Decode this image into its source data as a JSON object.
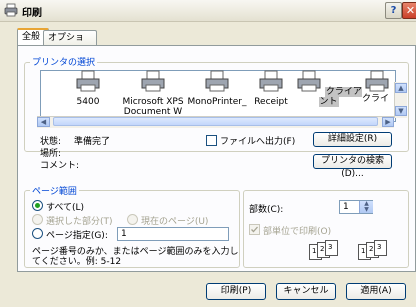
{
  "window": {
    "title": "印刷",
    "help_label": "?",
    "close_label": "✕"
  },
  "tabs": [
    {
      "label": "全般"
    },
    {
      "label": "オプション"
    }
  ],
  "printer_select": {
    "group_title": "プリンタの選択",
    "printers": [
      {
        "name": "5400"
      },
      {
        "name": "Microsoft XPS Document W"
      },
      {
        "name": "MonoPrinter_"
      },
      {
        "name": "Receipt"
      },
      {
        "name": "クライアント"
      },
      {
        "name": "クライ ント"
      }
    ],
    "status_label": "状態:",
    "status_value": "準備完了",
    "location_label": "場所:",
    "comment_label": "コメント:",
    "print_to_file_label": "ファイルへ出力(F)",
    "preferences_button": "詳細設定(R)",
    "find_printer_button": "プリンタの検索(D)..."
  },
  "page_range": {
    "group_title": "ページ範囲",
    "all_label": "すべて(L)",
    "selection_label": "選択した部分(T)",
    "current_page_label": "現在のページ(U)",
    "pages_label": "ページ指定(G):",
    "pages_value": "1",
    "hint_line1": "ページ番号のみか、またはページ範囲のみを入力し",
    "hint_line2": "てください。例: 5-12"
  },
  "copies": {
    "label": "部数(C):",
    "value": "1",
    "collate_label": "部単位で印刷(O)",
    "collate_numbers": [
      "1",
      "2",
      "3",
      "1",
      "2",
      "3"
    ]
  },
  "buttons": {
    "print": "印刷(P)",
    "cancel": "キャンセル",
    "apply": "適用(A)"
  },
  "colors": {
    "group_title": "#0046d5",
    "radio_dot": "#21a121"
  }
}
